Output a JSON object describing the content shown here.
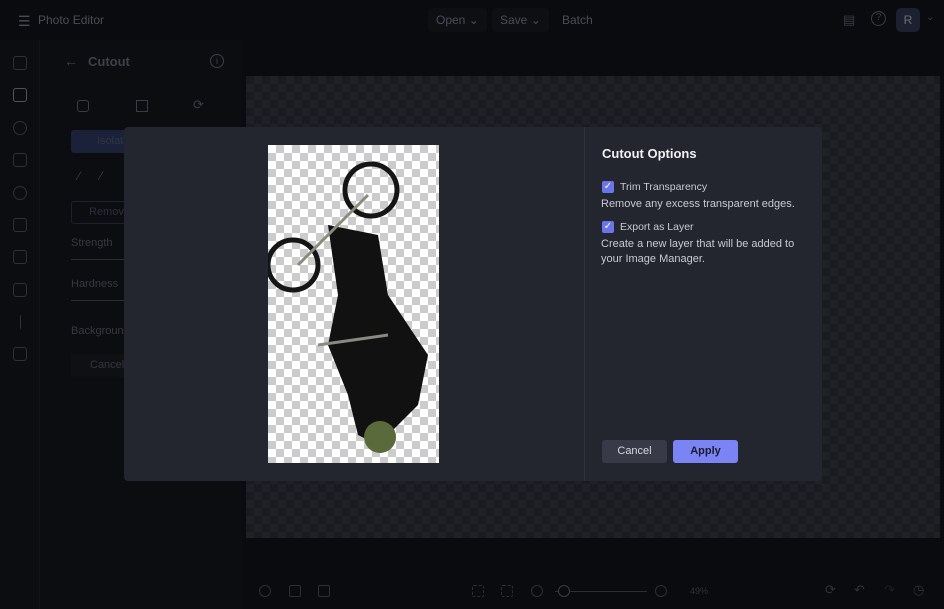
{
  "app": {
    "title": "Photo Editor",
    "menu": {
      "open": "Open",
      "save": "Save",
      "batch": "Batch"
    },
    "avatar_initial": "R"
  },
  "panel": {
    "title": "Cutout",
    "isolate_label": "Isolate",
    "remove_label": "Remove",
    "strength_label": "Strength",
    "hardness_label": "Hardness",
    "background_label": "Background",
    "cancel_label": "Cancel"
  },
  "toolbar": {
    "zoom": "49%"
  },
  "modal": {
    "title": "Cutout Options",
    "options": [
      {
        "label": "Trim Transparency",
        "checked": true,
        "description": "Remove any excess transparent edges."
      },
      {
        "label": "Export as Layer",
        "checked": true,
        "description": "Create a new layer that will be added to your Image Manager."
      }
    ],
    "cancel_label": "Cancel",
    "apply_label": "Apply",
    "colors": {
      "accent": "#7b84f5",
      "background": "#23252f"
    }
  }
}
